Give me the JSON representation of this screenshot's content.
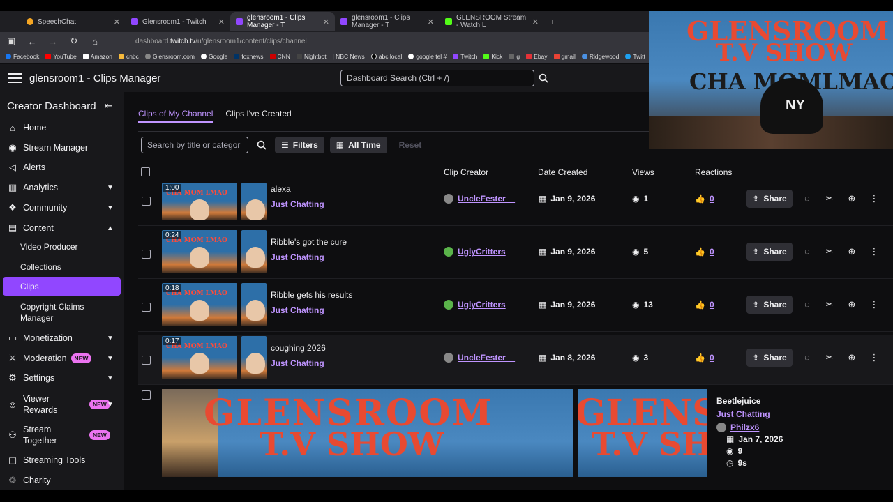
{
  "browser": {
    "tabs": [
      {
        "label": "SpeechChat",
        "color": "#f5a623"
      },
      {
        "label": "Glensroom1 - Twitch",
        "color": "#9147ff"
      },
      {
        "label": "glensroom1 - Clips Manager - T",
        "color": "#9147ff"
      },
      {
        "label": "glensroom1 - Clips Manager - T",
        "color": "#9147ff"
      },
      {
        "label": "GLENSROOM Stream - Watch L",
        "color": "#53fc18"
      }
    ],
    "url_prefix": "dashboard.",
    "url_domain": "twitch.tv",
    "url_path": "/u/glensroom1/content/clips/channel",
    "bookmarks": [
      "Facebook",
      "YouTube",
      "Amazon",
      "cnbc",
      "Glensroom.com",
      "Google",
      "foxnews",
      "CNN",
      "Nightbot",
      "| NBC News",
      "abc local",
      "google tel #",
      "Twitch",
      "Kick",
      "g",
      "Ebay",
      "gmail",
      "Ridgewood",
      "Twitt"
    ]
  },
  "header": {
    "title": "glensroom1 - Clips Manager",
    "search_placeholder": "Dashboard Search (Ctrl + /)"
  },
  "sidebar": {
    "title": "Creator Dashboard",
    "items": {
      "home": "Home",
      "stream_manager": "Stream Manager",
      "alerts": "Alerts",
      "analytics": "Analytics",
      "community": "Community",
      "content": "Content",
      "video_producer": "Video Producer",
      "collections": "Collections",
      "clips": "Clips",
      "copyright": "Copyright Claims Manager",
      "monetization": "Monetization",
      "moderation": "Moderation",
      "settings": "Settings",
      "viewer_rewards": "Viewer Rewards",
      "stream_together": "Stream Together",
      "streaming_tools": "Streaming Tools",
      "charity": "Charity"
    },
    "new_badge": "NEW"
  },
  "main": {
    "tabs": [
      "Clips of My Channel",
      "Clips I've Created"
    ],
    "search_placeholder": "Search by title or categor",
    "filters_label": "Filters",
    "time_label": "All Time",
    "reset_label": "Reset",
    "columns": {
      "creator": "Clip Creator",
      "date": "Date Created",
      "views": "Views",
      "reactions": "Reactions"
    },
    "share_label": "Share",
    "rows": [
      {
        "duration": "1:00",
        "title": "alexa",
        "category": "Just Chatting",
        "creator": "UncleFester__",
        "date": "Jan 9, 2026",
        "views": "1",
        "reactions": "0"
      },
      {
        "duration": "0:24",
        "title": "Ribble's got the cure",
        "category": "Just Chatting",
        "creator": "UglyCritters",
        "date": "Jan 9, 2026",
        "views": "5",
        "reactions": "0"
      },
      {
        "duration": "0:18",
        "title": "Ribble gets his results",
        "category": "Just Chatting",
        "creator": "UglyCritters",
        "date": "Jan 9, 2026",
        "views": "13",
        "reactions": "0"
      },
      {
        "duration": "0:17",
        "title": "coughing 2026",
        "category": "Just Chatting",
        "creator": "UncleFester__",
        "date": "Jan 8, 2026",
        "views": "3",
        "reactions": "0"
      }
    ],
    "expanded": {
      "title": "Beetlejuice",
      "category": "Just Chatting",
      "creator": "Philzx6",
      "date": "Jan 7, 2026",
      "views": "9",
      "duration": "9s",
      "banner_line1": "GLENSROOM",
      "banner_line2": "T.V SHOW"
    },
    "thumb_banner": "CHA MOM LMAO"
  },
  "webcam": {
    "line1": "GLENSROOM",
    "line2": "T.V SHOW",
    "line3": "CHA MOMLMAO",
    "cap_logo": "NY"
  }
}
